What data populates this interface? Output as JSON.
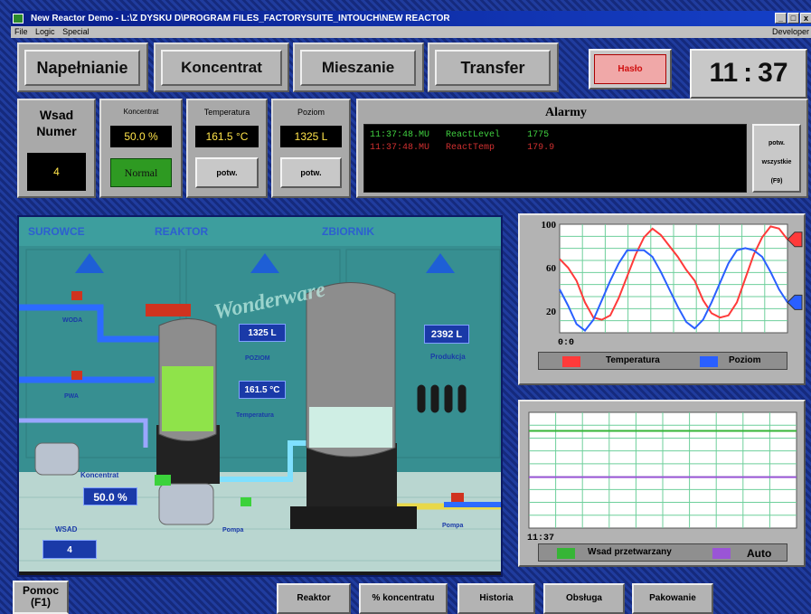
{
  "window": {
    "title": "New Reactor Demo - L:\\Z DYSKU D\\PROGRAM FILES_FACTORYSUITE_INTOUCH\\NEW REACTOR",
    "buttons": [
      "_",
      "□",
      "x"
    ]
  },
  "menu": {
    "items": [
      "File",
      "Logic",
      "Special"
    ],
    "right": "Developer"
  },
  "tabs": [
    {
      "label": "Napełnianie"
    },
    {
      "label": "Koncentrat"
    },
    {
      "label": "Mieszanie"
    },
    {
      "label": "Transfer"
    }
  ],
  "haslo": "Hasło",
  "clock": {
    "hh": "11",
    "sep": ":",
    "mm": "37"
  },
  "wsad": {
    "label1": "Wsad",
    "label2": "Numer",
    "value": "4"
  },
  "koncentrat": {
    "label": "Koncentrat",
    "value": "50.0 %",
    "status": "Normal"
  },
  "temperatura": {
    "label": "Temperatura",
    "value": "161.5 °C",
    "ack": "potw."
  },
  "poziom": {
    "label": "Poziom",
    "value": "1325 L",
    "ack": "potw."
  },
  "alarms": {
    "title": "Alarmy",
    "rows": [
      {
        "time": "11:37:48.MU",
        "name": "ReactLevel",
        "value": "1775",
        "color": "#40d040"
      },
      {
        "time": "11:37:48.MU",
        "name": "ReactTemp",
        "value": "179.9",
        "color": "#d03030"
      }
    ],
    "ack_all": [
      "potw.",
      "wszystkie",
      "(F9)"
    ]
  },
  "process": {
    "sections": [
      "SUROWCE",
      "REAKTOR",
      "ZBIORNIK"
    ],
    "woda": "WODA",
    "pwa": "PWA",
    "brand": "Wonderware",
    "level_value": "1325 L",
    "level_label": "POZIOM",
    "temp_value": "161.5 °C",
    "temp_label": "Temperatura",
    "prod_value": "2392 L",
    "prod_label": "Produkcja",
    "konc_label": "Koncentrat",
    "konc_value": "50.0 %",
    "wsad_label": "WSAD",
    "wsad_value": "4",
    "pompa1": "Pompa",
    "pompa2": "Pompa"
  },
  "chart_data": [
    {
      "type": "line",
      "y_ticks": [
        "100",
        "60",
        "20"
      ],
      "x_start": "0:0",
      "ylim": [
        0,
        100
      ],
      "series": [
        {
          "name": "Temperatura",
          "color": "#ff3a3a",
          "values": [
            68,
            60,
            48,
            28,
            14,
            12,
            16,
            32,
            52,
            72,
            88,
            96,
            90,
            80,
            70,
            58,
            48,
            30,
            18,
            14,
            16,
            28,
            50,
            72,
            88,
            98,
            96,
            86
          ]
        },
        {
          "name": "Poziom",
          "color": "#2a5fff",
          "values": [
            40,
            25,
            8,
            2,
            12,
            30,
            48,
            64,
            76,
            76,
            76,
            70,
            56,
            40,
            24,
            10,
            4,
            12,
            28,
            46,
            64,
            76,
            78,
            76,
            70,
            56,
            40,
            28
          ]
        }
      ]
    },
    {
      "type": "line",
      "x_start": "11:37",
      "ylim": [
        0,
        100
      ],
      "series": [
        {
          "name": "Wsad przetwarzany",
          "color": "#36b536",
          "values": [
            84,
            84
          ]
        },
        {
          "name": "Auto",
          "color": "#9a55d6",
          "values": [
            44,
            44
          ]
        }
      ]
    }
  ],
  "bottom": {
    "pomoc1": "Pomoc",
    "pomoc2": "(F1)",
    "buttons": [
      "Reaktor",
      "% koncentratu",
      "Historia",
      "Obsługa",
      "Pakowanie"
    ]
  }
}
